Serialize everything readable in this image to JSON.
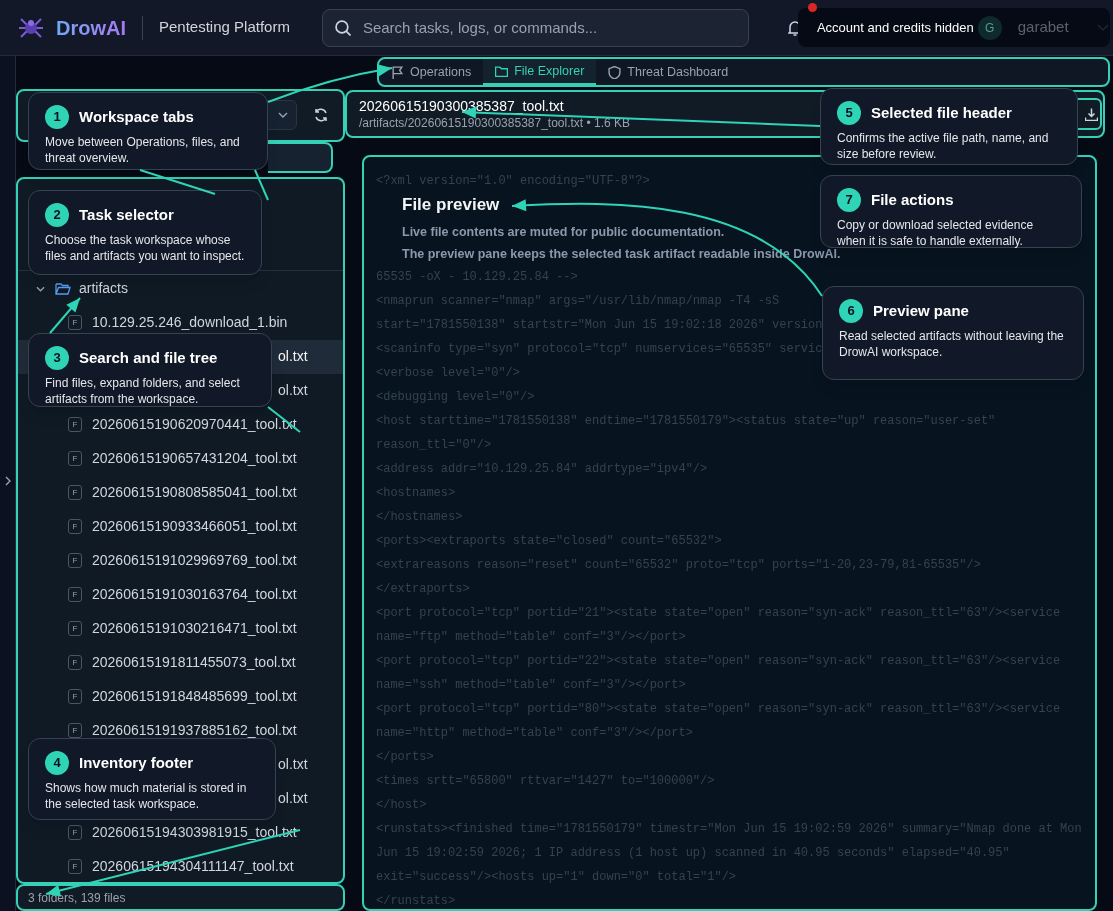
{
  "header": {
    "brand": "DrowAI",
    "subtitle": "Pentesting Platform",
    "search": {
      "placeholder": "Search tasks, logs, or commands..."
    },
    "notification_unread": true,
    "account": {
      "notice": "Account and credits hidden",
      "avatar": "G",
      "username": "garabet"
    }
  },
  "tabs": [
    {
      "label": "Operations",
      "selected": false
    },
    {
      "label": "File Explorer",
      "selected": true
    },
    {
      "label": "Threat Dashboard",
      "selected": false
    }
  ],
  "file_tree": {
    "items": [
      {
        "name": "artifacts",
        "kind": "folder",
        "expanded": true,
        "children": [
          {
            "name": "10.129.25.246_download_1.bin",
            "kind": "file",
            "badge": "F",
            "selected": false
          },
          {
            "name": "ol.txt",
            "kind": "fragment",
            "selected": true
          },
          {
            "name": "ol.txt",
            "kind": "fragment",
            "selected": false
          },
          {
            "name": "20260615190620970441_tool.txt",
            "kind": "file",
            "badge": "F",
            "selected": false
          },
          {
            "name": "20260615190657431204_tool.txt",
            "kind": "file",
            "badge": "F",
            "selected": false
          },
          {
            "name": "20260615190808585041_tool.txt",
            "kind": "file",
            "badge": "F",
            "selected": false
          },
          {
            "name": "20260615190933466051_tool.txt",
            "kind": "file",
            "badge": "F",
            "selected": false
          },
          {
            "name": "20260615191029969769_tool.txt",
            "kind": "file",
            "badge": "F",
            "selected": false
          },
          {
            "name": "20260615191030163764_tool.txt",
            "kind": "file",
            "badge": "F",
            "selected": false
          },
          {
            "name": "20260615191030216471_tool.txt",
            "kind": "file",
            "badge": "F",
            "selected": false
          },
          {
            "name": "20260615191811455073_tool.txt",
            "kind": "file",
            "badge": "F",
            "selected": false
          },
          {
            "name": "20260615191848485699_tool.txt",
            "kind": "file",
            "badge": "F",
            "selected": false
          },
          {
            "name": "20260615191937885162_tool.txt",
            "kind": "file",
            "badge": "F",
            "selected": false
          },
          {
            "name": "ol.txt",
            "kind": "fragment",
            "selected": false
          },
          {
            "name": "ol.txt",
            "kind": "fragment",
            "selected": false
          },
          {
            "name": "20260615194303981915_tool.txt",
            "kind": "file",
            "badge": "F",
            "selected": false
          },
          {
            "name": "20260615194304111147_tool.txt",
            "kind": "file",
            "badge": "F",
            "selected": false
          }
        ]
      }
    ],
    "footer": "3 folders, 139 files"
  },
  "file_header": {
    "name": "20260615190300385387_tool.txt",
    "path": "/artifacts/20260615190300385387_tool.txt • 1.6 KB"
  },
  "preview": {
    "lines": [
      {
        "kind": "code",
        "text": "<?xml version=\"1.0\" encoding=\"UTF-8\"?>"
      },
      {
        "kind": "notice",
        "title": "File preview",
        "text": [
          "Live file contents are muted for public documentation.",
          "The preview pane keeps the selected task artifact readable inside DrowAI."
        ]
      },
      {
        "kind": "code",
        "text": "65535 -oX - 10.129.25.84 -->"
      },
      {
        "kind": "code",
        "text": "<nmaprun scanner=\"nmap\" args=\"/usr/lib/nmap/nmap -T4 -sS"
      },
      {
        "kind": "code",
        "text": "start=\"1781550138\" startstr=\"Mon Jun 15 19:02:18 2026\" version"
      },
      {
        "kind": "code",
        "text": "<scaninfo type=\"syn\" protocol=\"tcp\" numservices=\"65535\" servic"
      },
      {
        "kind": "code",
        "text": "<verbose level=\"0\"/>"
      },
      {
        "kind": "code",
        "text": "<debugging level=\"0\"/>"
      },
      {
        "kind": "code",
        "text": "<host starttime=\"1781550138\" endtime=\"1781550179\"><status state=\"up\" reason=\"user-set\""
      },
      {
        "kind": "code",
        "text": "reason_ttl=\"0\"/>"
      },
      {
        "kind": "code",
        "text": "<address addr=\"10.129.25.84\" addrtype=\"ipv4\"/>"
      },
      {
        "kind": "code",
        "text": "<hostnames>"
      },
      {
        "kind": "code",
        "text": "</hostnames>"
      },
      {
        "kind": "code",
        "text": "<ports><extraports state=\"closed\" count=\"65532\">"
      },
      {
        "kind": "code",
        "text": "<extrareasons reason=\"reset\" count=\"65532\" proto=\"tcp\" ports=\"1-20,23-79,81-65535\"/>"
      },
      {
        "kind": "code",
        "text": "</extraports>"
      },
      {
        "kind": "code",
        "text": "<port protocol=\"tcp\" portid=\"21\"><state state=\"open\" reason=\"syn-ack\" reason_ttl=\"63\"/><service"
      },
      {
        "kind": "code",
        "text": "name=\"ftp\" method=\"table\" conf=\"3\"/></port>"
      },
      {
        "kind": "code",
        "text": "<port protocol=\"tcp\" portid=\"22\"><state state=\"open\" reason=\"syn-ack\" reason_ttl=\"63\"/><service"
      },
      {
        "kind": "code",
        "text": "name=\"ssh\" method=\"table\" conf=\"3\"/></port>"
      },
      {
        "kind": "code",
        "text": "<port protocol=\"tcp\" portid=\"80\"><state state=\"open\" reason=\"syn-ack\" reason_ttl=\"63\"/><service"
      },
      {
        "kind": "code",
        "text": "name=\"http\" method=\"table\" conf=\"3\"/></port>"
      },
      {
        "kind": "code",
        "text": "</ports>"
      },
      {
        "kind": "code",
        "text": "<times srtt=\"65800\" rttvar=\"1427\" to=\"100000\"/>"
      },
      {
        "kind": "code",
        "text": "</host>"
      },
      {
        "kind": "code",
        "text": "<runstats><finished time=\"1781550179\" timestr=\"Mon Jun 15 19:02:59 2026\" summary=\"Nmap done at Mon"
      },
      {
        "kind": "code",
        "text": "Jun 15 19:02:59 2026; 1 IP address (1 host up) scanned in 40.95 seconds\" elapsed=\"40.95\""
      },
      {
        "kind": "code",
        "text": "exit=\"success\"/><hosts up=\"1\" down=\"0\" total=\"1\"/>"
      },
      {
        "kind": "code",
        "text": "</runstats>"
      }
    ]
  },
  "callouts": [
    {
      "number": "1",
      "title": "Workspace tabs",
      "text": "Move between Operations, files, and threat overview."
    },
    {
      "number": "2",
      "title": "Task selector",
      "text": "Choose the task workspace whose files and artifacts you want to inspect."
    },
    {
      "number": "3",
      "title": "Search and file tree",
      "text": "Find files, expand folders, and select artifacts from the workspace."
    },
    {
      "number": "4",
      "title": "Inventory footer",
      "text": "Shows how much material is stored in the selected task workspace."
    },
    {
      "number": "5",
      "title": "Selected file header",
      "text": "Confirms the active file path, name, and size before review."
    },
    {
      "number": "7",
      "title": "File actions",
      "text": "Copy or download selected evidence when it is safe to handle externally."
    },
    {
      "number": "6",
      "title": "Preview pane",
      "text": "Read selected artifacts without leaving the DrowAI workspace."
    }
  ]
}
